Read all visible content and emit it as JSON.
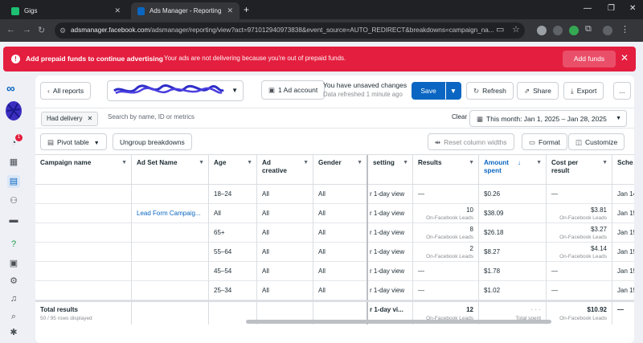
{
  "browser": {
    "tabs": [
      {
        "title": "Gigs",
        "active": false
      },
      {
        "title": "Ads Manager - Reporting - View",
        "active": true
      }
    ],
    "url_host": "adsmanager.facebook.com",
    "url_rest": "/adsmanager/reporting/view?act=971012940973838&event_source=AUTO_REDIRECT&breakdowns=campaign_na..."
  },
  "alert": {
    "title": "Add prepaid funds to continue advertising",
    "message": "Your ads are not delivering because you're out of prepaid funds.",
    "action": "Add funds",
    "color": "#e41e3f"
  },
  "header": {
    "back_label": "All reports",
    "ad_account_label": "1 Ad account",
    "unsaved": "You have unsaved changes",
    "refreshed": "Data refreshed 1 minute ago",
    "save_label": "Save",
    "refresh_label": "Refresh",
    "share_label": "Share",
    "export_label": "Export",
    "more_label": "..."
  },
  "filters": {
    "chip": "Had delivery",
    "search_placeholder": "Search by name, ID or metrics",
    "clear_label": "Clear",
    "date_range": "This month: Jan 1, 2025 – Jan 28, 2025"
  },
  "toolbar": {
    "pivot": "Pivot table",
    "ungroup": "Ungroup breakdowns",
    "reset": "Reset column widths",
    "format": "Format",
    "customize": "Customize"
  },
  "table": {
    "columns": [
      "Campaign name",
      "Ad Set Name",
      "Age",
      "Ad creative",
      "Gender",
      "setting",
      "Results",
      "Amount spent",
      "Cost per result",
      "Sche"
    ],
    "adset_name": "Lead Form Campaig...",
    "rows": [
      {
        "age": "18–24",
        "creative": "All",
        "gender": "All",
        "setting": "r 1-day view",
        "results": "—",
        "results_sub": "",
        "spent": "$0.26",
        "cpr": "—",
        "cpr_sub": "",
        "sched": "Jan 14"
      },
      {
        "age": "All",
        "creative": "All",
        "gender": "All",
        "setting": "r 1-day view",
        "results": "10",
        "results_sub": "On-Facebook Leads",
        "spent": "$38.09",
        "cpr": "$3.81",
        "cpr_sub": "On-Facebook Leads",
        "sched": "Jan 15"
      },
      {
        "age": "65+",
        "creative": "All",
        "gender": "All",
        "setting": "r 1-day view",
        "results": "8",
        "results_sub": "On-Facebook Leads",
        "spent": "$26.18",
        "cpr": "$3.27",
        "cpr_sub": "On-Facebook Leads",
        "sched": "Jan 15"
      },
      {
        "age": "55–64",
        "creative": "All",
        "gender": "All",
        "setting": "r 1-day view",
        "results": "2",
        "results_sub": "On-Facebook Leads",
        "spent": "$8.27",
        "cpr": "$4.14",
        "cpr_sub": "On-Facebook Leads",
        "sched": "Jan 15"
      },
      {
        "age": "45–54",
        "creative": "All",
        "gender": "All",
        "setting": "r 1-day view",
        "results": "—",
        "results_sub": "",
        "spent": "$1.78",
        "cpr": "—",
        "cpr_sub": "",
        "sched": "Jan 15"
      },
      {
        "age": "25–34",
        "creative": "All",
        "gender": "All",
        "setting": "r 1-day view",
        "results": "—",
        "results_sub": "",
        "spent": "$1.02",
        "cpr": "—",
        "cpr_sub": "",
        "sched": "Jan 15"
      }
    ],
    "totals": {
      "label": "Total results",
      "sub": "50 / 95 rows displayed",
      "setting": "r 1-day vi...",
      "results": "12",
      "results_sub": "On-Facebook Leads",
      "spent_sub": "Total spent",
      "cpr": "$10.92",
      "cpr_sub": "On-Facebook Leads",
      "sched": "—"
    }
  }
}
